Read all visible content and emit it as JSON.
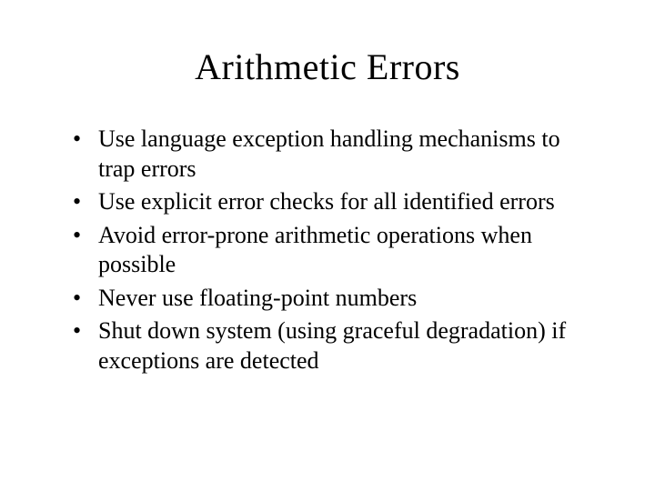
{
  "title": "Arithmetic Errors",
  "bullets": [
    "Use language exception handling mechanisms to trap errors",
    "Use explicit error checks for all identified errors",
    "Avoid error-prone arithmetic operations when possible",
    "Never use floating-point numbers",
    "Shut down system (using graceful degradation) if exceptions are detected"
  ]
}
